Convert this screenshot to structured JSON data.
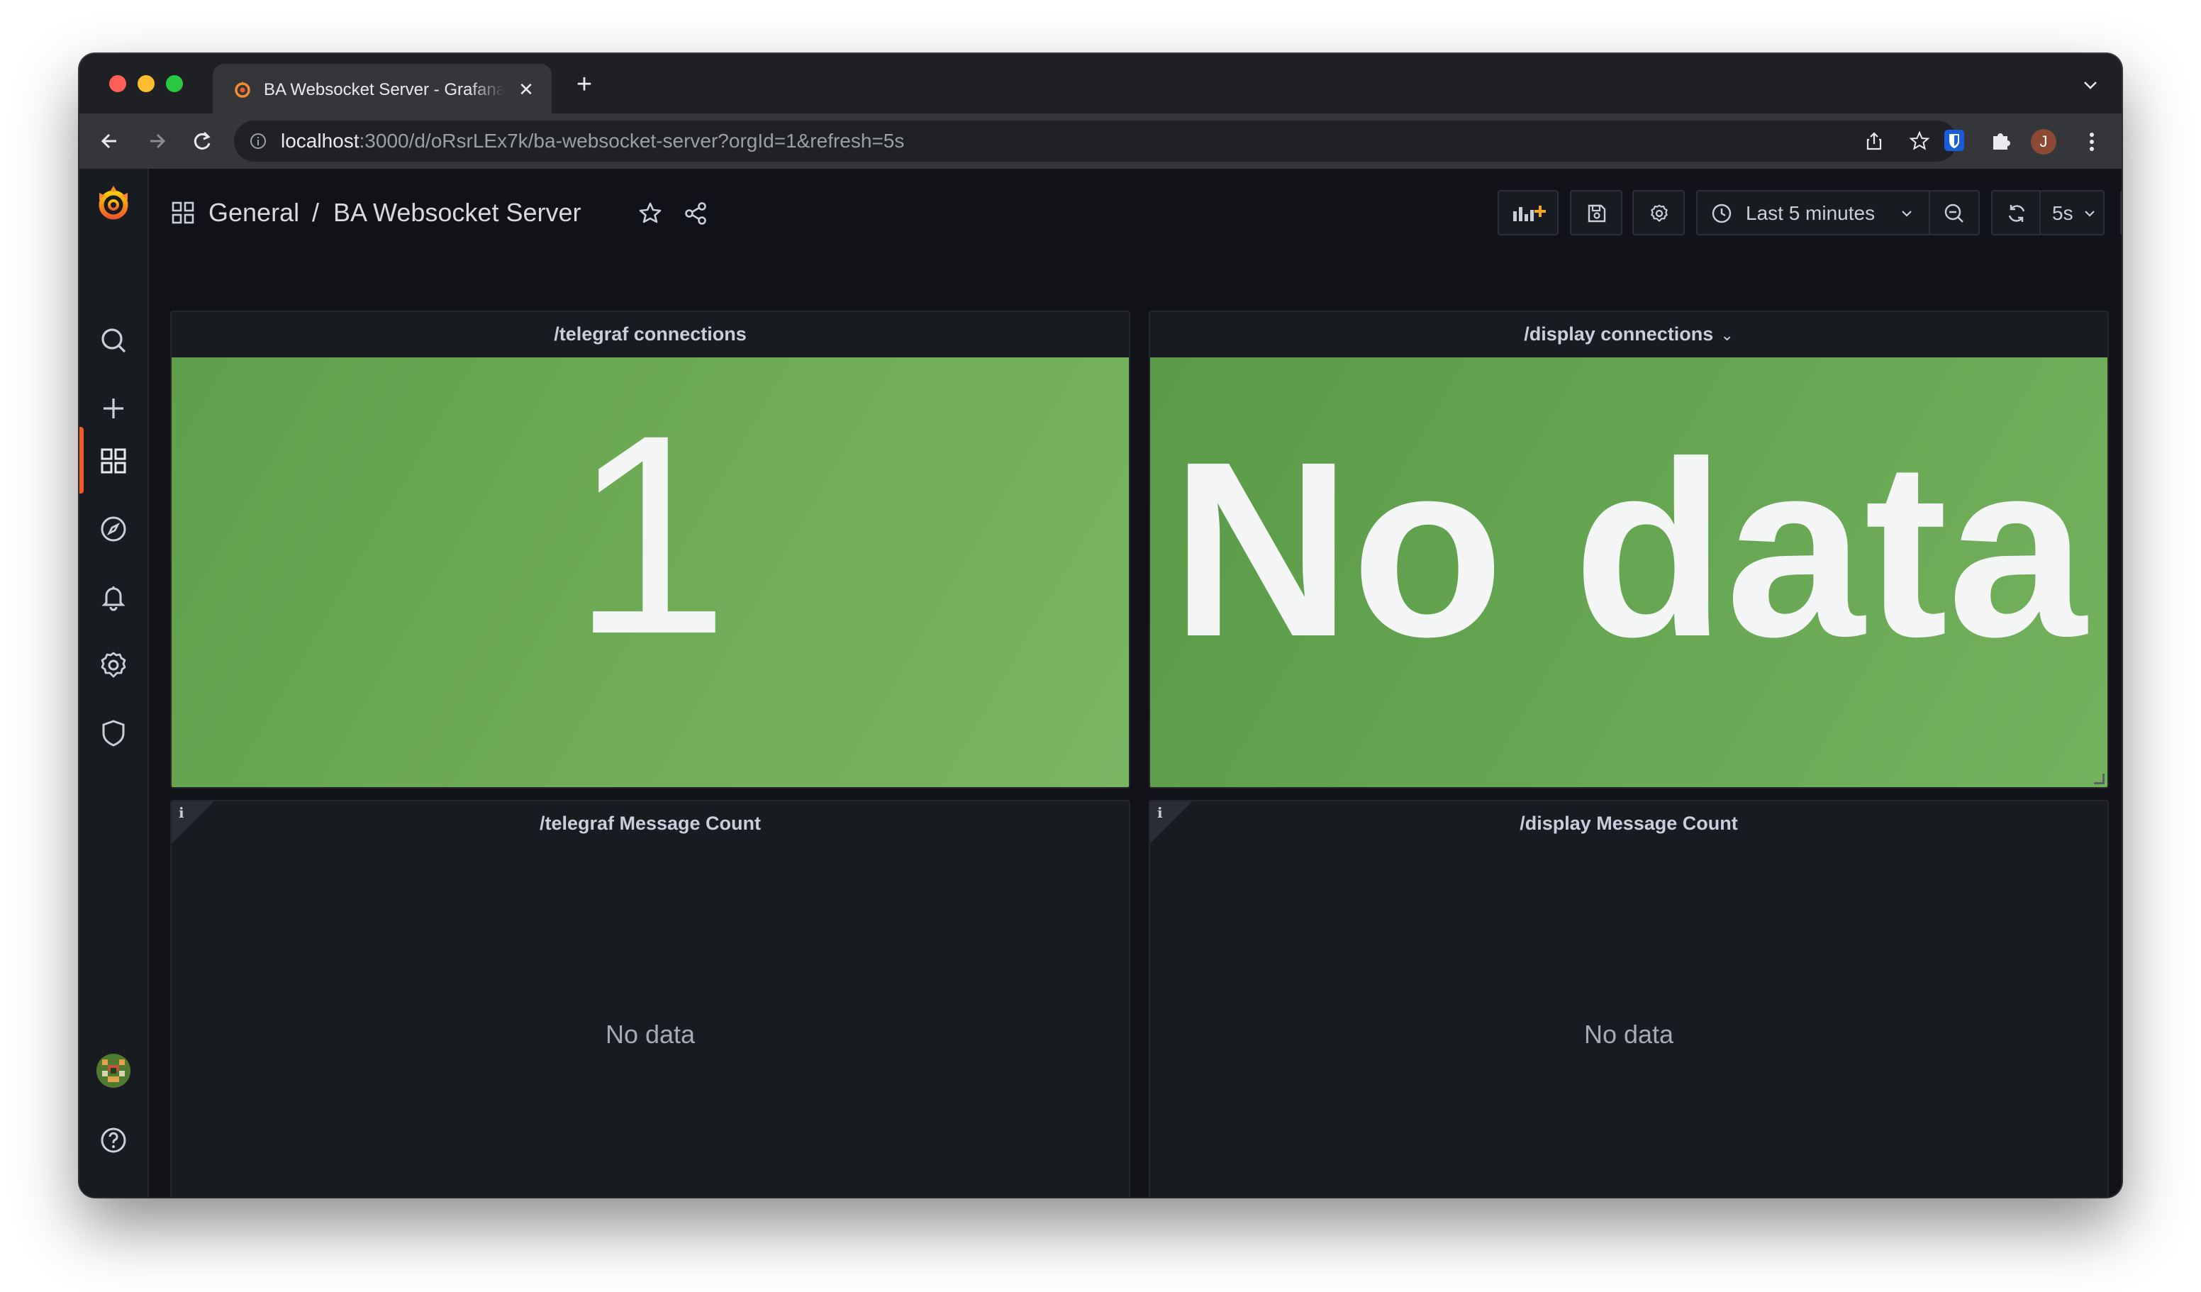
{
  "browser": {
    "tab_title": "BA Websocket Server - Grafana",
    "url_host": "localhost",
    "url_rest": ":3000/d/oRsrLEx7k/ba-websocket-server?orgId=1&refresh=5s",
    "profile_initial": "J",
    "new_tab_glyph": "+",
    "close_glyph": "✕"
  },
  "sidemenu": {
    "items": [
      "grafana-logo-icon",
      "search-icon",
      "create-icon",
      "dashboards-icon",
      "explore-icon",
      "alerting-icon",
      "configuration-icon",
      "server-admin-icon",
      "user-avatar",
      "help-icon"
    ],
    "active": "dashboards-icon"
  },
  "dashboard": {
    "folder": "General",
    "separator": "/",
    "title": "BA Websocket Server",
    "time_range": "Last 5 minutes",
    "refresh_interval": "5s"
  },
  "panels": [
    {
      "title": "/telegraf connections",
      "value": "1"
    },
    {
      "title": "/display connections",
      "value": "No data"
    },
    {
      "title": "/telegraf Message Count",
      "value": "No data",
      "info": "i"
    },
    {
      "title": "/display Message Count",
      "value": "No data",
      "info": "i"
    }
  ],
  "colors": {
    "stat_green": "#6fab56",
    "grafana_orange": "#f05a28",
    "background": "#111217",
    "panel_bg": "#181b1f"
  }
}
